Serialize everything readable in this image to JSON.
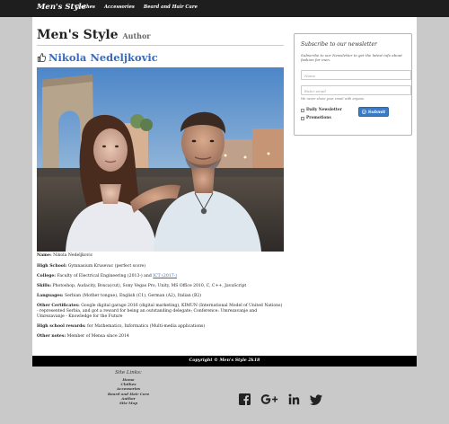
{
  "nav": {
    "brand": "Men's Style",
    "links": [
      "Clothes",
      "Accessories",
      "Beard and Hair Care"
    ]
  },
  "header": {
    "title": "Men's Style",
    "subtitle": "Author"
  },
  "profile": {
    "name": "Nikola Nedeljkovic",
    "photo_alt": "Nikola Nedeljkovic"
  },
  "info": {
    "name_label": "Name:",
    "name_value": "Nikola Nedeljkovic",
    "highschool_label": "High School:",
    "highschool_value": "Gymnasium Krusevac (perfect score)",
    "college_label": "College:",
    "college_value_pre": "Faculty of Electrical Engineering (2013-) and ",
    "college_link": "ICT (2017-)",
    "skills_label": "Skills:",
    "skills_value": "Photoshop, Audacity, Boxca(cut), Sony Vegas Pro, Unity, MS Office 2010, C, C++, JavaScript",
    "languages_label": "Languages:",
    "languages_value": "Serbian (Mother tongue), English (C1), German (A2), Italian (B2)",
    "certs_label": "Other Certificates:",
    "certs_value": "Google digital garage 2016 (digital marketing), KIMUN (International Model of United Nations) - represented Serbia, and got a reward for being an outstanding delegate; Conference: Umrezavanje and Umrezavanje - Knowledge for the Future",
    "rewards_label": "High school rewards:",
    "rewards_value": "for Mathematics, Informatics (Multi-media applications)",
    "notes_label": "Other notes:",
    "notes_value": "Member of Mensa since 2014"
  },
  "newsletter": {
    "title": "Subscribe to our newsletter",
    "subtitle": "Subscribe to our Newsletter to get the latest info about fashion for men.",
    "name_placeholder": "Name",
    "email_placeholder": "Enter email",
    "email_hint": "We never share your email with anyone.",
    "option_daily": "Daily Newsletter",
    "option_promotions": "Promotions",
    "submit_label": "Submit"
  },
  "footer": {
    "copyright": "Copyright © Men's Style 2k18",
    "links_heading": "Site Links:",
    "links": [
      "Home",
      "Clothes",
      "Accessories",
      "Beard and Hair Care",
      "Author",
      "Site Map"
    ]
  }
}
